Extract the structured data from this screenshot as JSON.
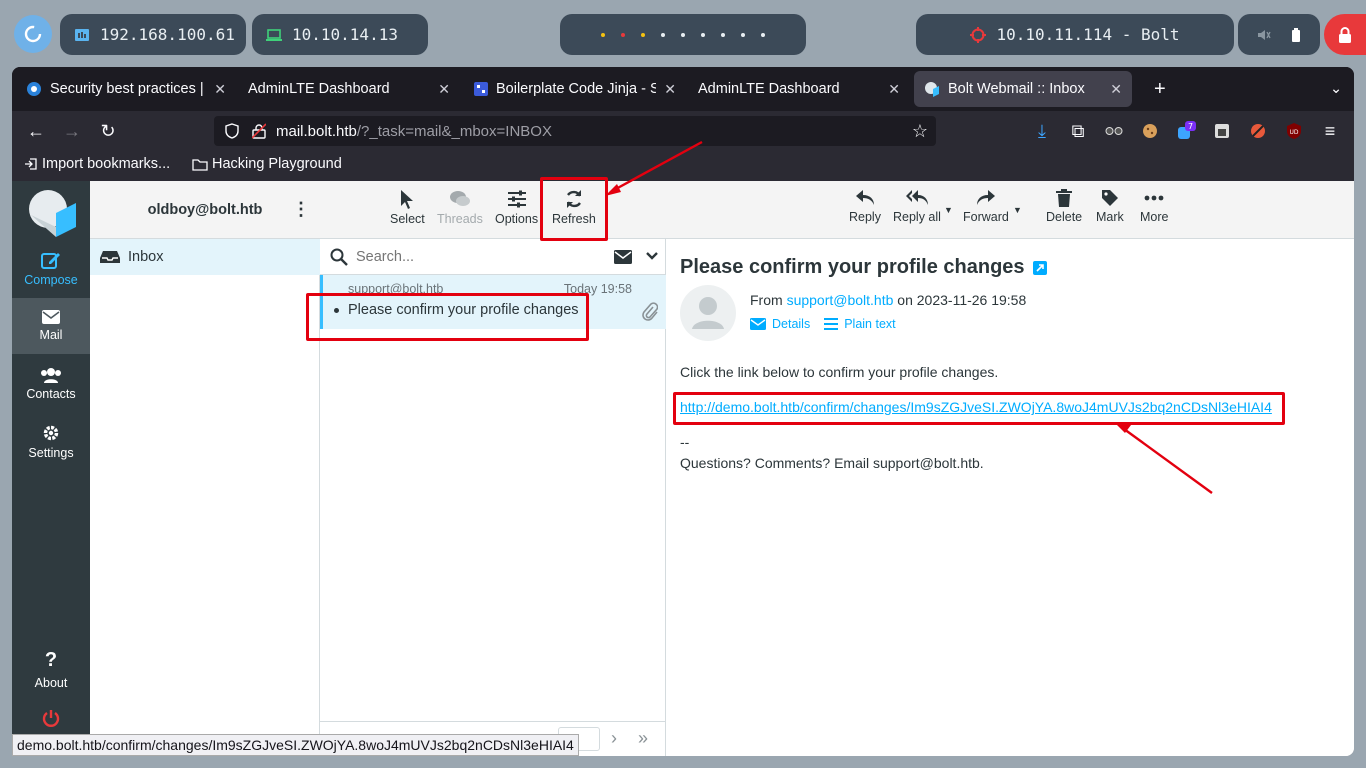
{
  "system": {
    "ip_local": "192.168.100.61",
    "ip_vpn": "10.10.14.13",
    "target": "10.10.11.114 - Bolt"
  },
  "browser": {
    "tabs": [
      {
        "title": "Security best practices |"
      },
      {
        "title": "AdminLTE Dashboard"
      },
      {
        "title": "Boilerplate Code Jinja - S"
      },
      {
        "title": "AdminLTE Dashboard"
      },
      {
        "title": "Bolt Webmail :: Inbox"
      }
    ],
    "url_host": "mail.bolt.htb",
    "url_path": "/?_task=mail&_mbox=INBOX",
    "bookmarks": {
      "import": "Import bookmarks...",
      "folder": "Hacking Playground"
    },
    "ext_badge": "7",
    "ext_ublock": "UD",
    "status_url": "demo.bolt.htb/confirm/changes/Im9sZGJveSI.ZWOjYA.8woJ4mUVJs2bq2nCDsNl3eHIAI4"
  },
  "sidebar_menu": {
    "compose": "Compose",
    "mail": "Mail",
    "contacts": "Contacts",
    "settings": "Settings",
    "about": "About"
  },
  "account": "oldboy@bolt.htb",
  "folders": [
    {
      "name": "Inbox"
    }
  ],
  "list_toolbar": {
    "select": "Select",
    "threads": "Threads",
    "options": "Options",
    "refresh": "Refresh"
  },
  "search": {
    "placeholder": "Search..."
  },
  "messages": [
    {
      "from": "support@bolt.htb",
      "date": "Today 19:58",
      "subject": "Please confirm your profile changes"
    }
  ],
  "reader_toolbar": {
    "reply": "Reply",
    "reply_all": "Reply all",
    "forward": "Forward",
    "delete": "Delete",
    "mark": "Mark",
    "more": "More"
  },
  "email": {
    "subject": "Please confirm your profile changes",
    "from_label": "From",
    "from_addr": "support@bolt.htb",
    "date_text": "on 2023-11-26 19:58",
    "details": "Details",
    "plain_text": "Plain text",
    "body_line": "Click the link below to confirm your profile changes.",
    "link": "http://demo.bolt.htb/confirm/changes/Im9sZGJveSI.ZWOjYA.8woJ4mUVJs2bq2nCDsNl3eHIAI4",
    "sig_sep": "--",
    "footer": "Questions? Comments? Email support@bolt.htb."
  },
  "colors": {
    "accent": "#37beff",
    "annotation": "#e3000f",
    "sidebar": "#2f3a3f"
  }
}
